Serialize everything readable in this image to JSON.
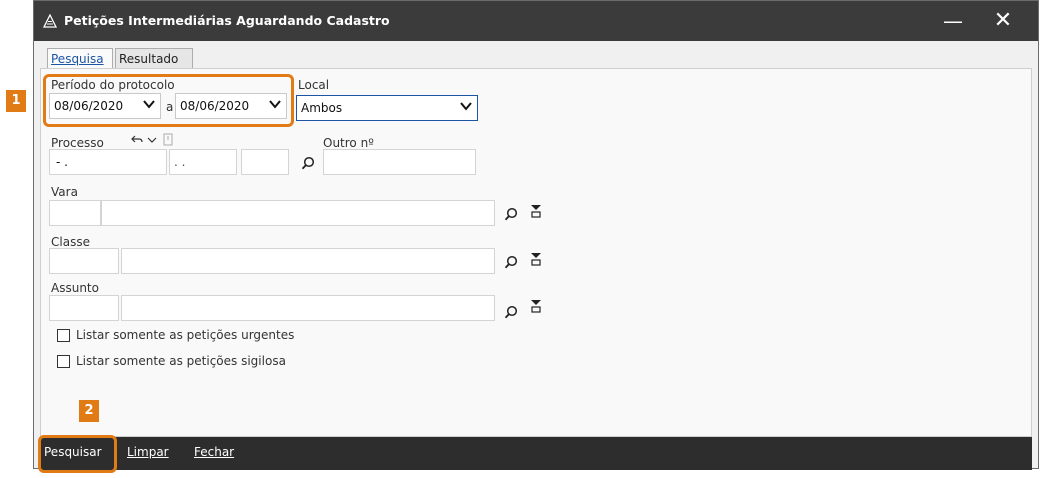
{
  "window": {
    "title": "Petições Intermediárias Aguardando Cadastro",
    "minimize_glyph": "—",
    "close_glyph": "✕"
  },
  "tabs": [
    {
      "label": "Pesquisa"
    },
    {
      "label": "Resultado"
    }
  ],
  "form": {
    "periodo": {
      "label": "Período do protocolo",
      "from": "08/06/2020",
      "connector": "a",
      "to": "08/06/2020"
    },
    "local": {
      "label": "Local",
      "value": "Ambos"
    },
    "processo": {
      "label": "Processo",
      "part1": "- .",
      "part2": ". ."
    },
    "outro": {
      "label": "Outro nº"
    },
    "vara": {
      "label": "Vara"
    },
    "classe": {
      "label": "Classe"
    },
    "assunto": {
      "label": "Assunto"
    },
    "checks": [
      {
        "label": "Listar somente as petições urgentes",
        "checked": false
      },
      {
        "label": "Listar somente as petições sigilosa",
        "checked": false
      }
    ]
  },
  "actions": {
    "pesquisar": "Pesquisar",
    "limpar": "Limpar",
    "fechar": "Fechar"
  },
  "badges": {
    "one": "1",
    "two": "2"
  },
  "colors": {
    "titlebar": "#3b3b3b",
    "highlight": "#e07b16",
    "bottombar": "#2d2d2d"
  }
}
